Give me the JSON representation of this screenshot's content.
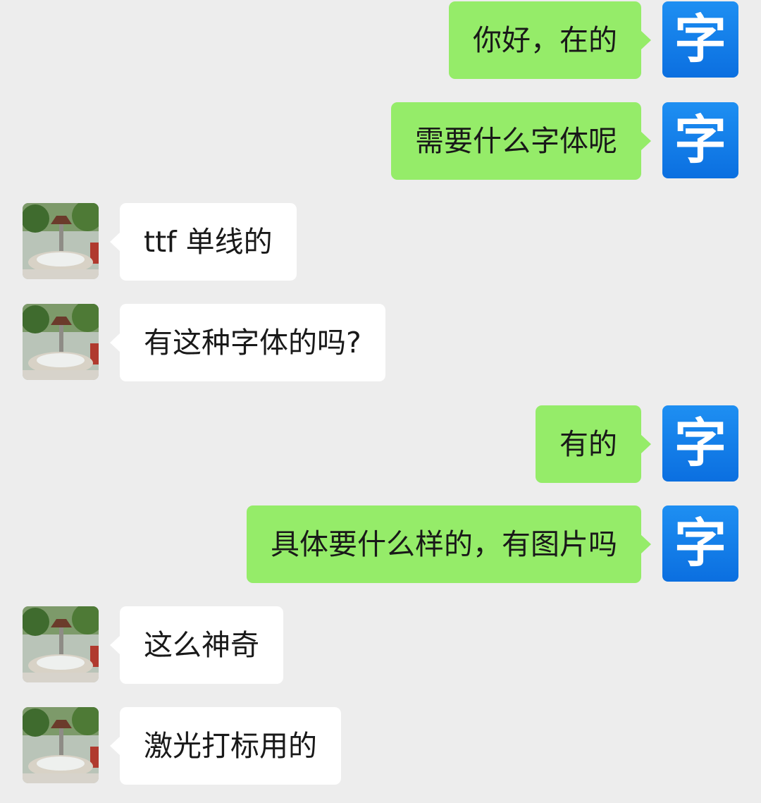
{
  "chat": {
    "self_avatar_glyph": "字",
    "messages": [
      {
        "from": "self",
        "text": "你好，在的"
      },
      {
        "from": "self",
        "text": "需要什么字体呢"
      },
      {
        "from": "other",
        "text": "ttf 单线的"
      },
      {
        "from": "other",
        "text": "有这种字体的吗?"
      },
      {
        "from": "self",
        "text": "有的"
      },
      {
        "from": "self",
        "text": "具体要什么样的，有图片吗"
      },
      {
        "from": "other",
        "text": "这么神奇"
      },
      {
        "from": "other",
        "text": "激光打标用的"
      }
    ]
  },
  "colors": {
    "background": "#ededed",
    "outgoing_bubble": "#95ec69",
    "incoming_bubble": "#ffffff",
    "self_avatar": "#1e8ff2"
  },
  "icons": {
    "self_avatar": "character-zi-avatar",
    "other_avatar": "fountain-photo-avatar"
  }
}
